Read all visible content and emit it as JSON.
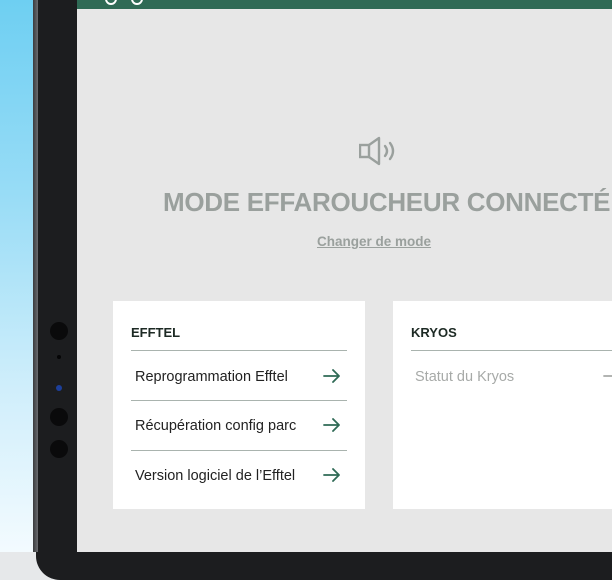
{
  "screen": {
    "mode_title": "MODE EFFAROUCHEUR CONNECTÉ",
    "change_mode_link": "Changer de mode",
    "status_icon": "speaker-icon"
  },
  "cards": {
    "efftel": {
      "title": "EFFTEL",
      "items": [
        {
          "label": "Reprogrammation Efftel",
          "icon": "arrow-right-icon"
        },
        {
          "label": "Récupération config parc",
          "icon": "arrow-right-icon"
        },
        {
          "label": "Version logiciel de l’Efftel",
          "icon": "arrow-right-icon"
        }
      ]
    },
    "kryos": {
      "title": "KRYOS",
      "items": [
        {
          "label": "Statut du Kryos",
          "icon": "arrow-right-icon"
        }
      ]
    }
  },
  "colors": {
    "accent_green": "#2f6a55",
    "screen_bg": "#e7e7e7",
    "muted_text": "#9aa09d",
    "arrow_green": "#2f6a55"
  }
}
